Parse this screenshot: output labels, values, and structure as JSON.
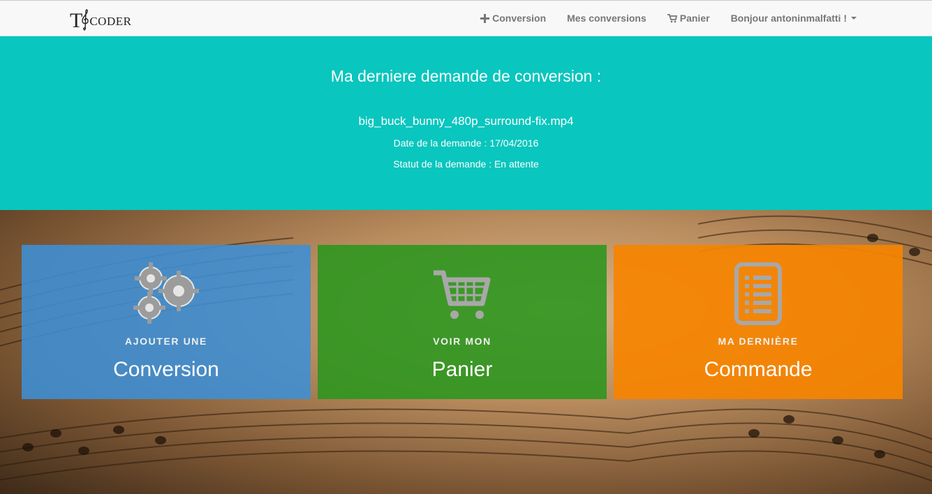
{
  "navbar": {
    "brand_t": "T",
    "brand_rest": "CODER",
    "links": [
      {
        "label": "Conversion",
        "icon": "plus-icon"
      },
      {
        "label": "Mes conversions"
      },
      {
        "label": "Panier",
        "icon": "cart-icon"
      },
      {
        "label": "Bonjour antoninmalfatti !",
        "icon": "caret-down-icon"
      }
    ]
  },
  "hero": {
    "title": "Ma derniere demande de conversion :",
    "filename": "big_buck_bunny_480p_surround-fix.mp4",
    "date_line": "Date de la demande : 17/04/2016",
    "status_line": "Statut de la demande : En attente",
    "color": "#09c6be"
  },
  "tiles": [
    {
      "kicker": "AJOUTER UNE",
      "title": "Conversion",
      "icon": "gears-icon",
      "color": "#3e8fd6"
    },
    {
      "kicker": "VOIR MON",
      "title": "Panier",
      "icon": "cart-icon",
      "color": "#2a961e"
    },
    {
      "kicker": "MA DERNIÈRE",
      "title": "Commande",
      "icon": "list-document-icon",
      "color": "#f68400"
    }
  ]
}
